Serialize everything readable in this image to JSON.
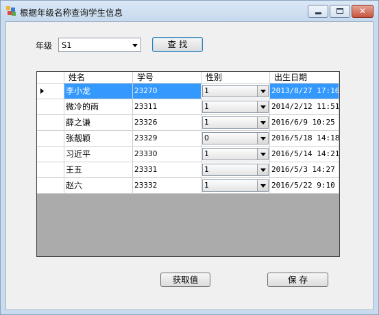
{
  "window": {
    "title": "根据年级名称查询学生信息"
  },
  "filter": {
    "grade_label": "年级",
    "grade_value": "S1",
    "search_label": "查 找"
  },
  "grid": {
    "columns": [
      "姓名",
      "学号",
      "性别",
      "出生日期"
    ],
    "rows": [
      {
        "name": "李小龙",
        "id": "23270",
        "gender": "1",
        "birth": "2013/8/27 17:16",
        "selected": true
      },
      {
        "name": "微冷的雨",
        "id": "23311",
        "gender": "1",
        "birth": "2014/2/12 11:51"
      },
      {
        "name": "薛之谦",
        "id": "23326",
        "gender": "1",
        "birth": "2016/6/9 10:25"
      },
      {
        "name": "张靓颖",
        "id": "23329",
        "gender": "0",
        "birth": "2016/5/18 14:18"
      },
      {
        "name": "习近平",
        "id": "23330",
        "gender": "1",
        "birth": "2016/5/14 14:21"
      },
      {
        "name": "王五",
        "id": "23331",
        "gender": "1",
        "birth": "2016/5/3 14:27"
      },
      {
        "name": "赵六",
        "id": "23332",
        "gender": "1",
        "birth": "2016/5/22 9:10"
      }
    ]
  },
  "footer": {
    "get_value_label": "获取值",
    "save_label": "保 存"
  },
  "colors": {
    "selection": "#3399ff",
    "grid_background": "#ababab",
    "window_frame": "#c9dcef"
  }
}
